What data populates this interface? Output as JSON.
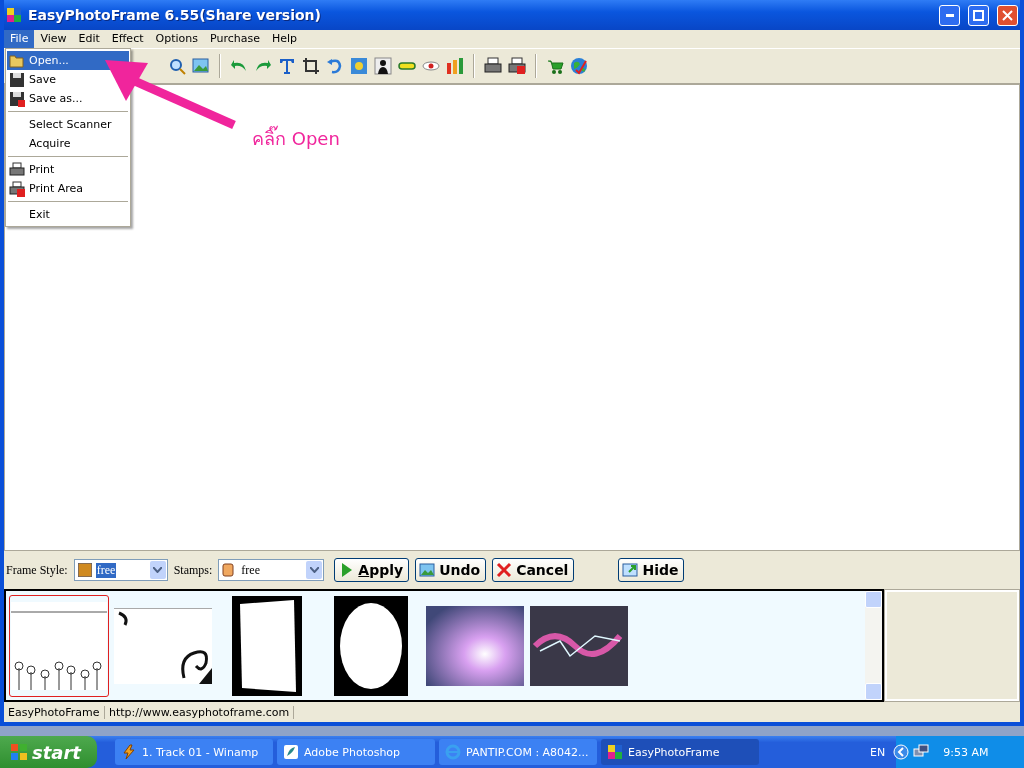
{
  "window": {
    "title": "EasyPhotoFrame 6.55(Share version)"
  },
  "menu_bar": [
    {
      "label": "File",
      "selected": true
    },
    {
      "label": "View",
      "selected": false
    },
    {
      "label": "Edit",
      "selected": false
    },
    {
      "label": "Effect",
      "selected": false
    },
    {
      "label": "Options",
      "selected": false
    },
    {
      "label": "Purchase",
      "selected": false
    },
    {
      "label": "Help",
      "selected": false
    }
  ],
  "file_menu": [
    {
      "kind": "open",
      "label": "Open...",
      "selected": true
    },
    {
      "kind": "save",
      "label": "Save",
      "selected": false
    },
    {
      "kind": "save-as",
      "label": "Save as...",
      "selected": false
    },
    {
      "kind": "separator"
    },
    {
      "kind": "plain",
      "label": "Select Scanner",
      "selected": false
    },
    {
      "kind": "plain",
      "label": "Acquire",
      "selected": false
    },
    {
      "kind": "separator"
    },
    {
      "kind": "print",
      "label": "Print",
      "selected": false
    },
    {
      "kind": "print-area",
      "label": "Print Area",
      "selected": false
    },
    {
      "kind": "separator"
    },
    {
      "kind": "plain",
      "label": "Exit",
      "selected": false
    }
  ],
  "annotation": {
    "text": "คลิ๊ก Open"
  },
  "frame_bar": {
    "frame_style_label": "Frame Style:",
    "frame_style_value": "free",
    "stamps_label": "Stamps:",
    "stamps_value": "free",
    "buttons": [
      {
        "kind": "apply",
        "label": "Apply",
        "mnemonic": true
      },
      {
        "kind": "undo",
        "label": "Undo",
        "mnemonic": false
      },
      {
        "kind": "cancel",
        "label": "Cancel",
        "mnemonic": false
      },
      {
        "kind": "hide",
        "label": "Hide",
        "mnemonic": false
      }
    ]
  },
  "thumbnails": [
    {
      "kind": "dandelion",
      "selected": true
    },
    {
      "kind": "swirl",
      "selected": false
    },
    {
      "kind": "torn-edge",
      "selected": false
    },
    {
      "kind": "oval",
      "selected": false
    },
    {
      "kind": "light-burst",
      "selected": false
    },
    {
      "kind": "neon",
      "selected": false
    }
  ],
  "status_bar": [
    "EasyPhotoFrame",
    "http://www.easyphotoframe.com"
  ],
  "taskbar": {
    "start": "start",
    "tasks": [
      {
        "kind": "winamp",
        "label": "1. Track 01 - Winamp",
        "selected": false
      },
      {
        "kind": "photoshop",
        "label": "Adobe Photoshop",
        "selected": false
      },
      {
        "kind": "browser",
        "label": "PANTIP.COM : A8042...",
        "selected": false
      },
      {
        "kind": "app",
        "label": "EasyPhotoFrame",
        "selected": true
      }
    ],
    "language": "EN",
    "clock": "9:53 AM"
  }
}
